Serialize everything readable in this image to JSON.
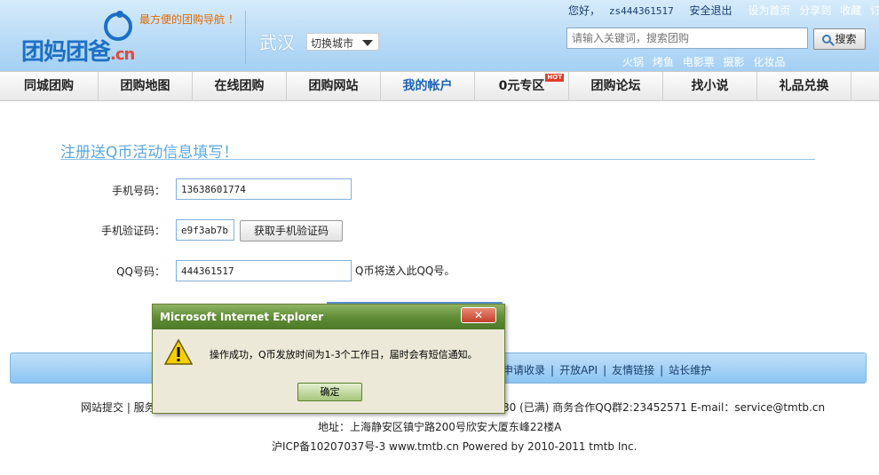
{
  "header": {
    "logo_text": "团妈团爸",
    "logo_suffix": ".cn",
    "slogan": "最方便的团购导航 ！",
    "city": "武汉",
    "city_switch": "切换城市",
    "greeting": "您好，",
    "username": "zs444361517",
    "logout": "安全退出",
    "top_links": [
      "设为首页",
      "分享到",
      "收藏",
      "订阅"
    ],
    "search_placeholder": "请输入关键词，搜索团购",
    "search_button": "搜索",
    "hotwords": [
      "火锅",
      "烤鱼",
      "电影票",
      "摄影",
      "化妆品"
    ]
  },
  "nav": {
    "items": [
      "同城团购",
      "团购地图",
      "在线团购",
      "团购网站",
      "我的帐户",
      "0元专区",
      "团购论坛",
      "找小说",
      "礼品兑换"
    ],
    "active_index": 4,
    "hot_badge": "HOT"
  },
  "form": {
    "title": "注册送Q币活动信息填写！",
    "phone_label": "手机号码：",
    "phone_value": "13638601774",
    "code_label": "手机验证码：",
    "code_value": "e9f3ab7b",
    "get_code_button": "获取手机验证码",
    "qq_label": "QQ号码：",
    "qq_value": "444361517",
    "qq_hint": "Q币将送入此QQ号。"
  },
  "footer": {
    "links": [
      "申请收录",
      "开放API",
      "友情链接",
      "站长维护"
    ],
    "line1_left": "网站提交 | 服务",
    "line1_right": "80 (已满) 商务合作QQ群2:23452571 E-mail：service@tmtb.cn",
    "line2": "地址：上海静安区镇宁路200号欣安大厦东峰22楼A",
    "line3": "沪ICP备10207037号-3 www.tmtb.cn Powered by 2010-2011 tmtb Inc."
  },
  "dialog": {
    "title": "Microsoft Internet Explorer",
    "close": "✕",
    "message": "操作成功，Q币发放时间为1-3个工作日，届时会有短信通知。",
    "ok": "确定"
  },
  "colors": {
    "header_bg": "#b7daf6",
    "nav_active": "#1c64b8",
    "dialog_title": "#5d8a33",
    "accent": "#5aa7e2"
  }
}
